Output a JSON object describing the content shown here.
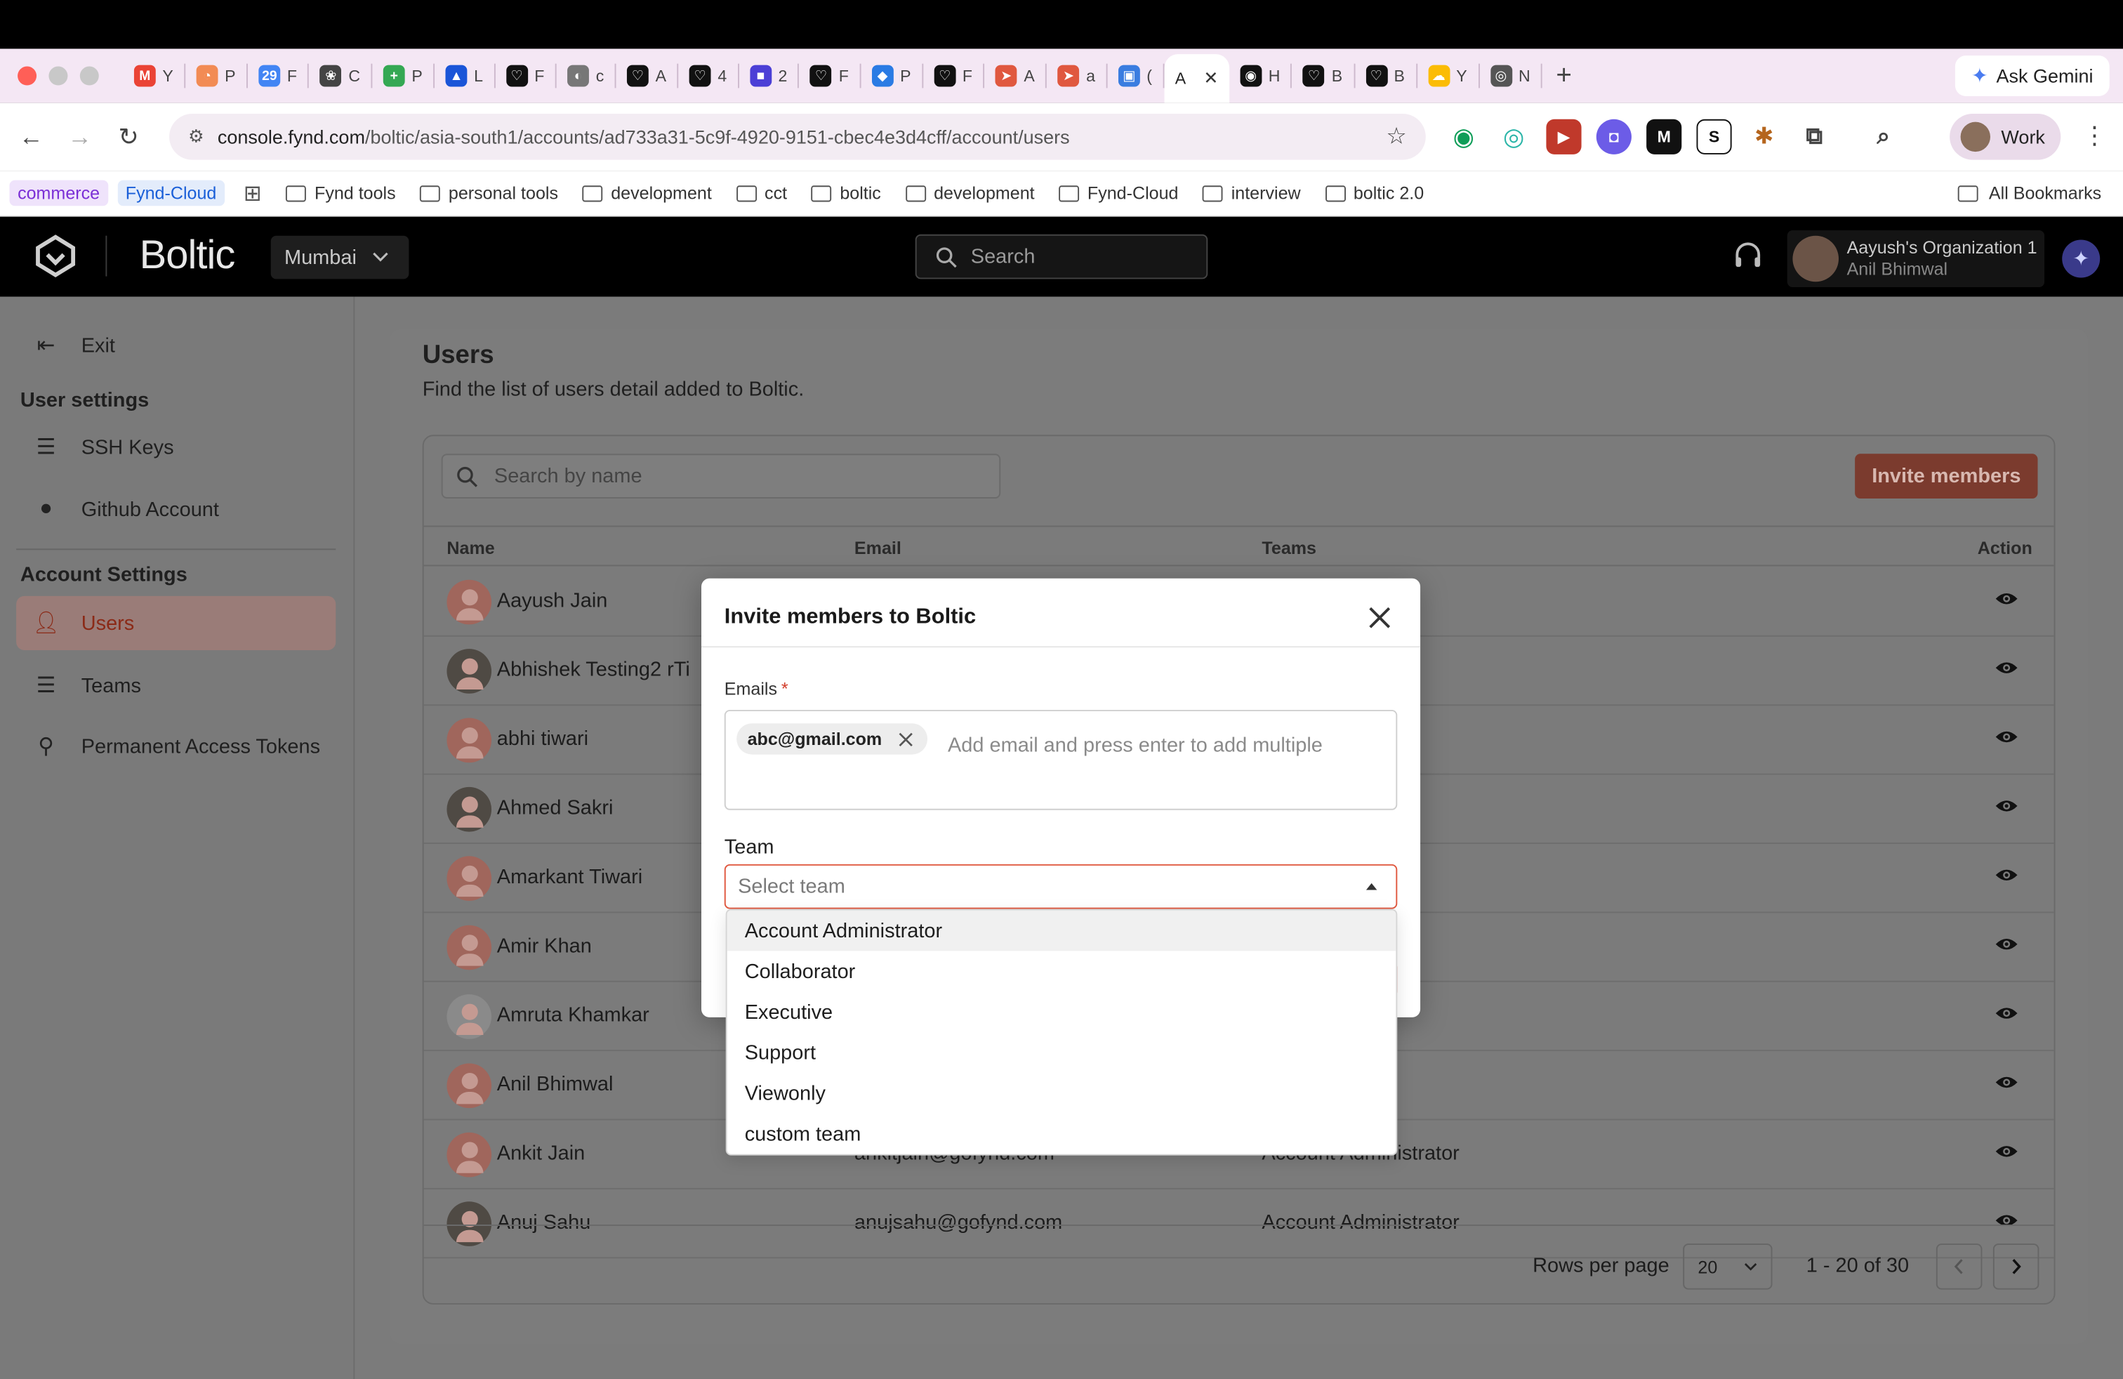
{
  "browser": {
    "tabs": [
      {
        "letter": "Y",
        "color": "#ea4335",
        "glyph": "M"
      },
      {
        "letter": "P",
        "color": "#f28b54",
        "glyph": "◔"
      },
      {
        "letter": "F",
        "color": "#4285f4",
        "glyph": "29"
      },
      {
        "letter": "C",
        "color": "#444444",
        "glyph": "❀"
      },
      {
        "letter": "P",
        "color": "#34a853",
        "glyph": "+"
      },
      {
        "letter": "L",
        "color": "#1a55d8",
        "glyph": "▲"
      },
      {
        "letter": "F",
        "color": "#111111",
        "glyph": "♡"
      },
      {
        "letter": "c",
        "color": "#777777",
        "glyph": "◐"
      },
      {
        "letter": "A",
        "color": "#111111",
        "glyph": "♡"
      },
      {
        "letter": "4",
        "color": "#111111",
        "glyph": "♡"
      },
      {
        "letter": "2",
        "color": "#4b3fd6",
        "glyph": "■"
      },
      {
        "letter": "F",
        "color": "#111111",
        "glyph": "♡"
      },
      {
        "letter": "P",
        "color": "#2a7be4",
        "glyph": "◆"
      },
      {
        "letter": "F",
        "color": "#111111",
        "glyph": "♡"
      },
      {
        "letter": "A",
        "color": "#e0583f",
        "glyph": "➤"
      },
      {
        "letter": "a",
        "color": "#e0583f",
        "glyph": "➤"
      },
      {
        "letter": "(",
        "color": "#3a7de0",
        "glyph": "▣"
      }
    ],
    "active_tab": {
      "letter": "A",
      "close": "✕"
    },
    "tabs_right": [
      {
        "letter": "H",
        "color": "#111111",
        "glyph": "◉"
      },
      {
        "letter": "B",
        "color": "#111111",
        "glyph": "♡"
      },
      {
        "letter": "B",
        "color": "#111111",
        "glyph": "♡"
      },
      {
        "letter": "Y",
        "color": "#fbbc05",
        "glyph": "☁"
      },
      {
        "letter": "N",
        "color": "#555555",
        "glyph": "◎"
      }
    ],
    "newtab": "+",
    "ask_gemini": "Ask Gemini",
    "url_host": "console.fynd.com",
    "url_path": "/boltic/asia-south1/accounts/ad733a31-5c9f-4920-9151-cbec4e3d4cff/account/users",
    "profile_label": "Work",
    "bookmarks": {
      "chips": [
        {
          "label": "commerce",
          "color": "#7b2fd6",
          "bg": "#efe3fb"
        },
        {
          "label": "Fynd-Cloud",
          "color": "#1a5fd8",
          "bg": "#e3ecfb"
        }
      ],
      "folders": [
        "Fynd tools",
        "personal tools",
        "development",
        "cct",
        "boltic",
        "development",
        "Fynd-Cloud",
        "interview",
        "boltic 2.0"
      ],
      "all": "All Bookmarks"
    }
  },
  "app": {
    "brand": "Boltic",
    "region": "Mumbai",
    "search_placeholder": "Search",
    "org_name": "Aayush's Organization 1",
    "org_user": "Anil Bhimwal"
  },
  "sidebar": {
    "exit": "Exit",
    "user_settings": "User settings",
    "ssh_keys": "SSH Keys",
    "github": "Github Account",
    "account_settings": "Account Settings",
    "users": "Users",
    "teams": "Teams",
    "tokens": "Permanent Access Tokens"
  },
  "main": {
    "title": "Users",
    "subtitle": "Find the list of users detail added to Boltic.",
    "search_placeholder": "Search by name",
    "invite_button": "Invite members",
    "columns": {
      "name": "Name",
      "email": "Email",
      "teams": "Teams",
      "action": "Action"
    },
    "rows": [
      {
        "name": "Aayush Jain",
        "email": "",
        "team": "trator",
        "extra": "",
        "avatar": "default"
      },
      {
        "name": "Abhishek Testing2 rTi",
        "email": "",
        "team": "trator",
        "extra": "+2",
        "avatar": "photo"
      },
      {
        "name": "abhi tiwari",
        "email": "",
        "team": "trator",
        "extra": "+1",
        "avatar": "default"
      },
      {
        "name": "Ahmed Sakri",
        "email": "",
        "team": "trator",
        "extra": "",
        "avatar": "photo"
      },
      {
        "name": "Amarkant Tiwari",
        "email": "",
        "team": "trator",
        "extra": "",
        "avatar": "default"
      },
      {
        "name": "Amir Khan",
        "email": "",
        "team": "trator",
        "extra": "",
        "avatar": "default"
      },
      {
        "name": "Amruta Khamkar",
        "email": "",
        "team": "trator",
        "extra": "",
        "avatar": "gray"
      },
      {
        "name": "Anil Bhimwal",
        "email": "",
        "team": "nistrator",
        "extra": "",
        "avatar": "default"
      },
      {
        "name": "Ankit Jain",
        "email": "ankitjain@gofynd.com",
        "team": "Account Administrator",
        "extra": "",
        "avatar": "default"
      },
      {
        "name": "Anuj Sahu",
        "email": "anujsahu@gofynd.com",
        "team": "Account Administrator",
        "extra": "",
        "avatar": "photo"
      }
    ],
    "rows_per_page_label": "Rows per page",
    "rows_per_page": "20",
    "range": "1 - 20 of 30"
  },
  "modal": {
    "title": "Invite members to Boltic",
    "emails_label": "Emails",
    "required_mark": "*",
    "email_chip": "abc@gmail.com",
    "email_placeholder": "Add email and press enter to add multiple",
    "team_label": "Team",
    "team_placeholder": "Select team",
    "team_options": [
      "Account Administrator",
      "Collaborator",
      "Executive",
      "Support",
      "Viewonly",
      "custom team"
    ]
  }
}
